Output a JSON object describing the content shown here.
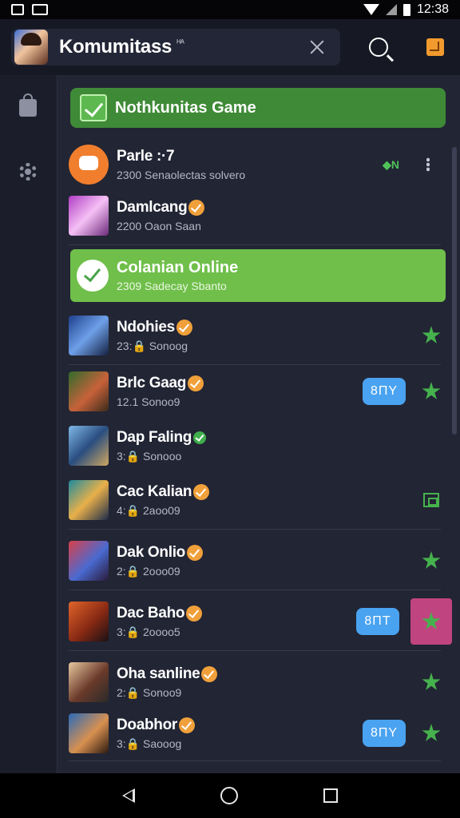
{
  "status_bar": {
    "time": "12:38"
  },
  "app_bar": {
    "title": "Komumitass",
    "title_suffix": "ᴴᴬ"
  },
  "banner": {
    "label": "Nothkunitas Game"
  },
  "list": {
    "items": [
      {
        "name": "Parle :·7",
        "sub": "2300 Senaolectas solvero",
        "tag": "◆N"
      },
      {
        "name": "Damlcang",
        "sub": "2200 Oaon Saan"
      },
      {
        "name": "Colanian Online",
        "sub": "2309 Sadecay Sbanto"
      },
      {
        "name": "Ndohies",
        "sub": "23:🔒 Sonoog"
      },
      {
        "name": "Brlc Gaag",
        "sub": "12.1 Sonoo9",
        "button": "8ΠΥ"
      },
      {
        "name": "Dap Faling",
        "sub": "3:🔒 Sonooo"
      },
      {
        "name": "Cac Kalian",
        "sub": "4:🔒 2aoo09"
      },
      {
        "name": "Dak Onlio",
        "sub": "2:🔒 2ooo09"
      },
      {
        "name": "Dac Baho",
        "sub": "3:🔒 2oooo5",
        "button": "8ΠΤ"
      },
      {
        "name": "Oha sanline",
        "sub": "2:🔒 Sonoo9"
      },
      {
        "name": "Doabhor",
        "sub": "3:🔒 Saooog",
        "button": "8ΠΥ"
      }
    ]
  },
  "icons": {
    "app_bar": [
      "avatar",
      "close-icon",
      "search-icon",
      "orange-badge-icon"
    ],
    "sidebar": [
      "lock-icon",
      "gear-icon"
    ],
    "nav": [
      "back-icon",
      "home-icon",
      "recents-icon"
    ]
  },
  "colors": {
    "accent_green": "#3f8a37",
    "highlight_green": "#6fbf4a",
    "button_blue": "#4aa3f0",
    "verified_orange": "#f0a03a",
    "magenta": "#c0447f"
  }
}
